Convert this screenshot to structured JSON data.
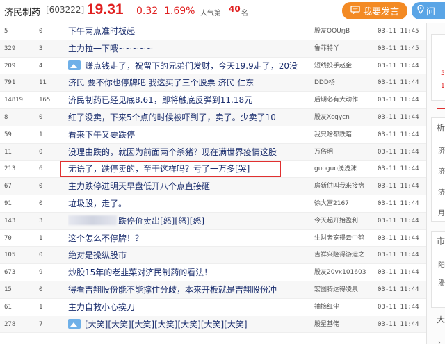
{
  "header": {
    "stock_name": "济民制药",
    "stock_code": "[603222]",
    "price": "19.31",
    "change": "0.32",
    "change_pct": "1.69%",
    "popularity_label": "人气第",
    "popularity_rank": "40",
    "popularity_unit": "名",
    "post_button": "我要发言",
    "ask_button": "问"
  },
  "posts": [
    {
      "reads": "5",
      "replies": "0",
      "title": "下午两点准时板起",
      "author": "股友OQUrjB",
      "time": "03-11 11:45",
      "image": false
    },
    {
      "reads": "329",
      "replies": "3",
      "title": "主力拉一下哦~~~~~",
      "author": "鲁菲特丫",
      "time": "03-11 11:45",
      "image": false
    },
    {
      "reads": "209",
      "replies": "4",
      "title": "赚点钱走了，祝留下的兄弟们发财，今天19.9走了，20没",
      "author": "短线投手赵金",
      "time": "03-11 11:44",
      "image": true
    },
    {
      "reads": "791",
      "replies": "11",
      "title": "济民 要不你也停牌吧 我这买了三个股票 济民 仁东",
      "author": "DDD杨",
      "time": "03-11 11:44",
      "image": false
    },
    {
      "reads": "14819",
      "replies": "165",
      "title": "济民制药已经见底8.61，即将触底反弹到11.18元",
      "author": "后期必有大动作",
      "time": "03-11 11:44",
      "image": false
    },
    {
      "reads": "8",
      "replies": "0",
      "title": "红了没卖，下来5个点的时候被吓到了，卖了。少卖了10",
      "author": "股友Xcqycn",
      "time": "03-11 11:44",
      "image": false
    },
    {
      "reads": "59",
      "replies": "1",
      "title": "看来下午又要跌停",
      "author": "我只啥都跌暗",
      "time": "03-11 11:44",
      "image": false
    },
    {
      "reads": "11",
      "replies": "0",
      "title": "没理由跌的，就因为前面两个杀猪？现在满世界疫情这股",
      "author": "万俗明",
      "time": "03-11 11:44",
      "image": false
    },
    {
      "reads": "213",
      "replies": "6",
      "title": "无语了，跌停卖的，至于这样吗？亏了一万多[哭]",
      "author": "guoguo浅浅沫",
      "time": "03-11 11:44",
      "image": false,
      "highlight": true
    },
    {
      "reads": "67",
      "replies": "0",
      "title": "主力跌停进明天早盘低开八个点直接砸",
      "author": "房新供叫我来接盘",
      "time": "03-11 11:44",
      "image": false
    },
    {
      "reads": "91",
      "replies": "0",
      "title": "垃圾股，走了。",
      "author": "徐大富2167",
      "time": "03-11 11:44",
      "image": false
    },
    {
      "reads": "143",
      "replies": "3",
      "title": "跌停价卖出[怒][怒][怒]",
      "author": "今天起开始盈利",
      "time": "03-11 11:44",
      "image": false,
      "blurred": true
    },
    {
      "reads": "70",
      "replies": "1",
      "title": "这个怎么不停牌！？",
      "author": "生财者宽得云中鹤",
      "time": "03-11 11:44",
      "image": false
    },
    {
      "reads": "105",
      "replies": "0",
      "title": "绝对是操纵股市",
      "author": "吉祥兴隆得游运之",
      "time": "03-11 11:44",
      "image": false
    },
    {
      "reads": "673",
      "replies": "9",
      "title": "炒股15年的老韭菜对济民制药的看法！",
      "author": "股友20vx101603",
      "time": "03-11 11:44",
      "image": false
    },
    {
      "reads": "15",
      "replies": "0",
      "title": "得看吉翔股份能不能撑住分歧，本来开板就是吉翔股份冲",
      "author": "宏图腾达得凌泉",
      "time": "03-11 11:44",
      "image": false
    },
    {
      "reads": "61",
      "replies": "1",
      "title": "主力自救小心挨刀",
      "author": "袖摘红尘",
      "time": "03-11 11:44",
      "image": false
    },
    {
      "reads": "278",
      "replies": "7",
      "title": "[大笑][大笑][大笑][大笑][大笑][大笑][大笑]",
      "author": "股星基佬",
      "time": "03-11 11:44",
      "image": true
    }
  ],
  "sidebar": {
    "glyphs": [
      "5",
      "1",
      "析",
      "济",
      "济",
      "济",
      "月",
      "市",
      "阳",
      "潘",
      "大"
    ]
  },
  "colors": {
    "price_red": "#e02020",
    "post_button": "#f38a24",
    "ask_button": "#5aa5e6",
    "title_link": "#1b2e6e",
    "highlight": "#e03030"
  }
}
